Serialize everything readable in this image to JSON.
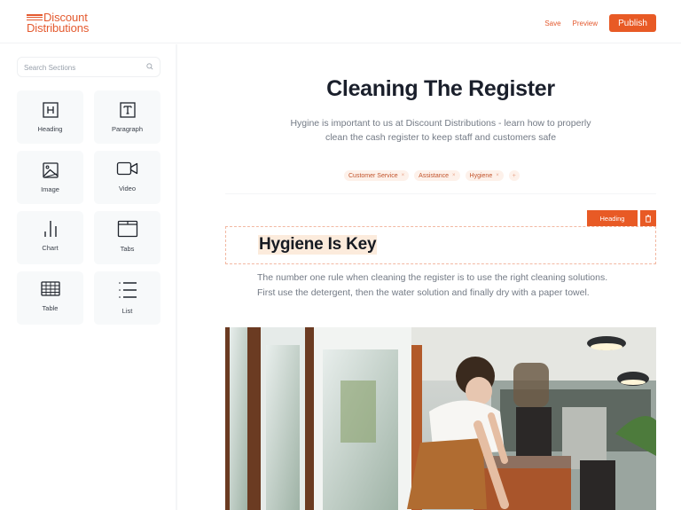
{
  "header": {
    "logo": {
      "line1": "Discount",
      "line2": "Distributions"
    },
    "save_label": "Save",
    "preview_label": "Preview",
    "publish_label": "Publish",
    "accent_color": "#e85a25"
  },
  "sidebar": {
    "search": {
      "placeholder": "Search Sections",
      "value": ""
    },
    "sections": [
      {
        "label": "Heading",
        "icon": "heading-icon"
      },
      {
        "label": "Paragraph",
        "icon": "paragraph-icon"
      },
      {
        "label": "Image",
        "icon": "image-icon"
      },
      {
        "label": "Video",
        "icon": "video-icon"
      },
      {
        "label": "Chart",
        "icon": "chart-icon"
      },
      {
        "label": "Tabs",
        "icon": "tabs-icon"
      },
      {
        "label": "Table",
        "icon": "table-icon"
      },
      {
        "label": "List",
        "icon": "list-icon"
      }
    ]
  },
  "page": {
    "title": "Cleaning The Register",
    "subtitle": "Hygine is important to us at Discount Distributions - learn how to properly clean the cash register to keep staff and customers safe",
    "tags": [
      {
        "label": "Customer Service"
      },
      {
        "label": "Assistance"
      },
      {
        "label": "Hygiene"
      }
    ],
    "tag_remove_glyph": "×",
    "tag_add_glyph": "+",
    "selected_block": {
      "type_label": "Heading",
      "text": "Hygiene Is Key"
    },
    "paragraph": "The number one rule when cleaning the register is to use the right cleaning solutions. First use the detergent, then the water solution and finally dry with a paper towel.",
    "image": {
      "description": "Barista in white t-shirt and brown apron wiping a cafe counter next to a coffee grinder and espresso machine"
    }
  }
}
